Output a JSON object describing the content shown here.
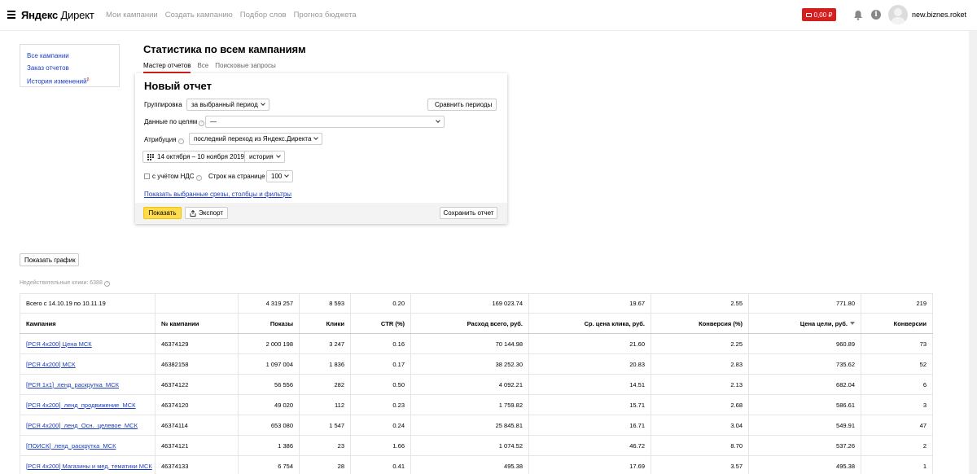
{
  "header": {
    "logo_brand": "Яндекс",
    "logo_product": "Директ",
    "nav": [
      "Мои кампании",
      "Создать кампанию",
      "Подбор слов",
      "Прогноз бюджета"
    ],
    "balance": "0,00 ₽",
    "username": "new.biznes.roket"
  },
  "sidebar": {
    "items": [
      "Все кампании",
      "Заказ отчетов",
      "История изменений"
    ]
  },
  "page": {
    "title": "Статистика по всем кампаниям",
    "tabs": [
      "Мастер отчетов",
      "Все",
      "Поисковые запросы"
    ]
  },
  "report": {
    "title": "Новый отчет",
    "grouping_label": "Группировка",
    "grouping_value": "за выбранный период",
    "compare_label": "Сравнить периоды",
    "goals_label": "Данные по целям",
    "goals_value": "—",
    "attribution_label": "Атрибуция",
    "attribution_value": "последний переход из Яндекс.Директа",
    "period_value": "14 октября – 10 ноября 2019",
    "history_value": "история",
    "vat_label": "с учётом НДС",
    "rows_label": "Строк на странице",
    "rows_value": "100",
    "slices_link": "Показать выбранные срезы, столбцы и фильтры",
    "show_button": "Показать",
    "export_button": "Экспорт",
    "save_button": "Сохранить отчет"
  },
  "controls": {
    "show_graph": "Показать график",
    "invalid_clicks": "Недействительные клики: 6388"
  },
  "table": {
    "totals": [
      "Всего с 14.10.19 по 10.11.19",
      "",
      "4 319 257",
      "8 593",
      "0.20",
      "169 023.74",
      "19.67",
      "2.55",
      "771.80",
      "219"
    ],
    "columns": [
      "Кампания",
      "№ кампании",
      "Показы",
      "Клики",
      "CTR (%)",
      "Расход всего, руб.",
      "Ср. цена клика, руб.",
      "Конверсия (%)",
      "Цена цели, руб.",
      "Конверсии"
    ],
    "rows": [
      [
        "[РСЯ 4x200] Цена МСК",
        "46374129",
        "2 000 198",
        "3 247",
        "0.16",
        "70 144.98",
        "21.60",
        "2.25",
        "960.89",
        "73"
      ],
      [
        "[РСЯ 4x200] МСК",
        "46382158",
        "1 097 004",
        "1 836",
        "0.17",
        "38 252.30",
        "20.83",
        "2.83",
        "735.62",
        "52"
      ],
      [
        "[РСЯ 1x1]_ленд_раскрутка_МСК",
        "46374122",
        "56 556",
        "282",
        "0.50",
        "4 092.21",
        "14.51",
        "2.13",
        "682.04",
        "6"
      ],
      [
        "[РСЯ 4x200]_ленд_продвижение_МСК",
        "46374120",
        "49 020",
        "112",
        "0.23",
        "1 759.82",
        "15.71",
        "2.68",
        "586.61",
        "3"
      ],
      [
        "[РСЯ 4x200]_ленд_Осн._целевое_МСК",
        "46374114",
        "653 080",
        "1 547",
        "0.24",
        "25 845.81",
        "16.71",
        "3.04",
        "549.91",
        "47"
      ],
      [
        "[ПОИСК]_ленд_раскрутка_МСК",
        "46374121",
        "1 386",
        "23",
        "1.66",
        "1 074.52",
        "46.72",
        "8.70",
        "537.26",
        "2"
      ],
      [
        "[РСЯ 4x200] Магазины и мед. тематики МСК",
        "46374133",
        "6 754",
        "28",
        "0.41",
        "495.38",
        "17.69",
        "3.57",
        "495.38",
        "1"
      ]
    ]
  },
  "colors": {
    "accent_red": "#d41f1f",
    "link_blue": "#1a3dc1",
    "button_yellow": "#ffdb4d"
  }
}
